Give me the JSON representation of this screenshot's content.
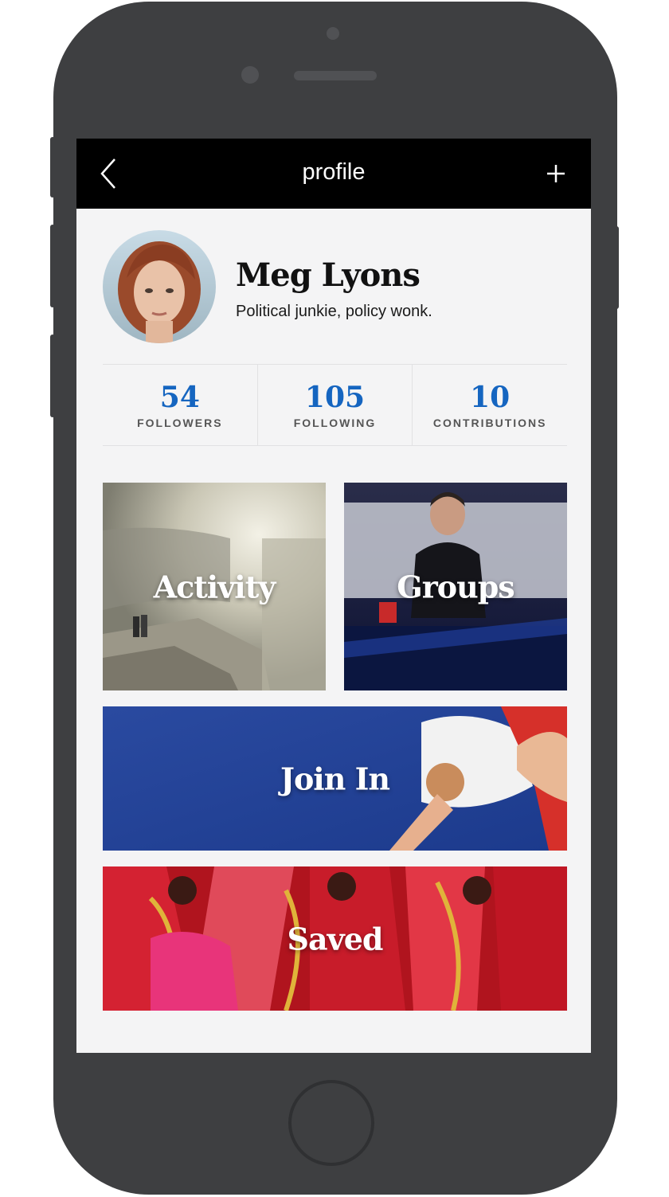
{
  "header": {
    "title": "profile",
    "back_icon": "chevron-left-icon",
    "add_icon": "plus-icon"
  },
  "profile": {
    "name": "Meg Lyons",
    "bio": "Political junkie, policy wonk."
  },
  "stats": [
    {
      "value": "54",
      "label": "FOLLOWERS"
    },
    {
      "value": "105",
      "label": "FOLLOWING"
    },
    {
      "value": "10",
      "label": "CONTRIBUTIONS"
    }
  ],
  "tiles": {
    "activity": "Activity",
    "groups": "Groups",
    "join_in": "Join In",
    "saved": "Saved"
  },
  "colors": {
    "accent": "#1565c0",
    "navbar": "#000000",
    "phone_body": "#3e3f41",
    "screen_bg": "#f4f4f5"
  }
}
